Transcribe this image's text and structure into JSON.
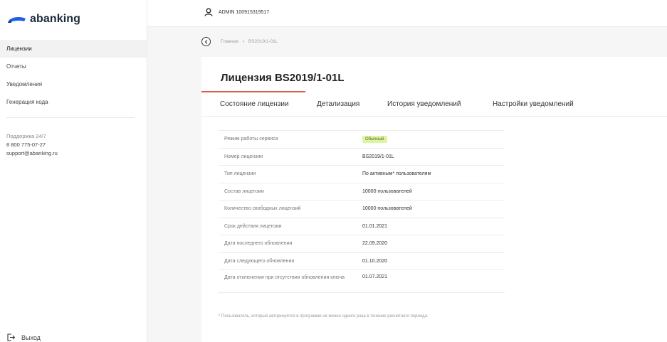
{
  "app": {
    "logo_text": "abanking"
  },
  "sidebar": {
    "items": [
      {
        "label": "Лицензии"
      },
      {
        "label": "Отчеты"
      },
      {
        "label": "Уведомления"
      },
      {
        "label": "Генерация кода"
      }
    ],
    "support": {
      "title": "Поддержка 24/7",
      "phone": "8 800 775-07-27",
      "email": "support@abanking.ru"
    },
    "logout_label": "Выход"
  },
  "header": {
    "user_label": "ADMIN 100915319517"
  },
  "breadcrumb": {
    "home": "Главная",
    "separator": "‹",
    "current": "BS2019/1-01L"
  },
  "card": {
    "title": "Лицензия BS2019/1-01L",
    "tabs": [
      {
        "label": "Состояние лицензии"
      },
      {
        "label": "Детализация"
      },
      {
        "label": "История уведомлений"
      },
      {
        "label": "Настройки уведомлений"
      }
    ],
    "rows": [
      {
        "label": "Режим работы сервиса",
        "value": "Обычный"
      },
      {
        "label": "Номер лицензии",
        "value": "BS2019/1-01L"
      },
      {
        "label": "Тип лицензии",
        "value": "По активным* пользователям"
      },
      {
        "label": "Состав лицензии",
        "value": "10000 пользователей"
      },
      {
        "label": "Количество свободных лицензий",
        "value": "10000 пользователей"
      },
      {
        "label": "Срок действия лицензии",
        "value": "01.01.2021"
      },
      {
        "label": "Дата последнего обновления",
        "value": "22.09.2020"
      },
      {
        "label": "Дата следующего обновления",
        "value": "01.10.2020"
      },
      {
        "label": "Дата отключения при отсутствии обновления ключа",
        "value": "01.07.2021"
      }
    ],
    "footnote": "* Пользователь, который авторизуется в программе не менее одного раза в течение расчетного периода."
  },
  "colors": {
    "accent": "#e05a47",
    "badge_bg": "#dff3a5",
    "logo_blue": "#1f5fe0"
  },
  "icons": {
    "user": "user-icon",
    "back": "back-arrow-icon",
    "logout": "logout-icon",
    "logo": "abanking-logo-mark"
  }
}
